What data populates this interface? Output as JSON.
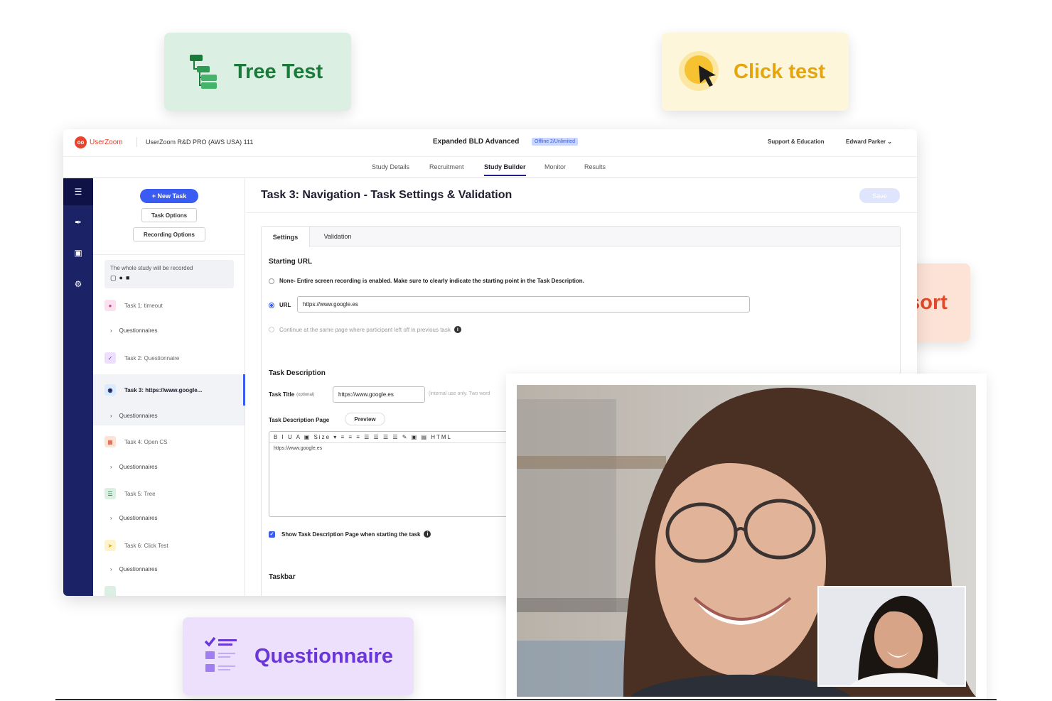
{
  "features": {
    "tree": "Tree Test",
    "click": "Click test",
    "card": "Card sort",
    "quest": "Questionnaire"
  },
  "topbar": {
    "brand": "UserZoom",
    "org": "UserZoom R&D PRO (AWS USA) 111",
    "study_title": "Expanded BLD Advanced",
    "badge": "Offline 2/Unlimited",
    "support": "Support & Education",
    "user": "Edward Parker ⌄"
  },
  "tabs": [
    "Study Details",
    "Recruitment",
    "Study Builder",
    "Monitor",
    "Results"
  ],
  "sidebar": {
    "new_task": "+ New Task",
    "task_options": "Task Options",
    "recording_options": "Recording Options",
    "recording_note": "The whole study will be recorded",
    "tasks": [
      "Task 1: timeout",
      "Task 2: Questionnaire",
      "Task 3: https://www.google...",
      "Task 4: Open CS",
      "Task 5: Tree",
      "Task 6: Click Test"
    ],
    "questionnaires": "Questionnaires"
  },
  "main": {
    "title": "Task 3: Navigation - Task Settings & Validation",
    "save": "Save",
    "tab_settings": "Settings",
    "tab_validation": "Validation",
    "starting_url": "Starting URL",
    "none_label": "None",
    "none_desc": " - Entire screen recording is enabled. Make sure to clearly indicate the starting point in the Task Description.",
    "url_label": "URL",
    "url_value": "https://www.google.es",
    "continue_label": "Continue at the same page where participant left off in previous task",
    "task_description": "Task Description",
    "task_title_label": "Task Title",
    "task_title_optional": "(optional)",
    "task_title_value": "https://www.google.es",
    "task_title_hint": "(internal use only. Two word",
    "desc_page_label": "Task Description Page",
    "preview": "Preview",
    "editor_tools": "B I U A ▣ Size ▾ ≡ ≡ ≡ ☰ ☰ ☰ ☰ ✎ ▣ ▤ HTML",
    "editor_body": "https://www.google.es",
    "show_desc": "Show Task Description Page when starting the task",
    "taskbar": "Taskbar"
  },
  "colors": {
    "rail": "#1c2266",
    "accent": "#3a5cf2",
    "tree": "#197a3a",
    "click": "#e4a50f",
    "card": "#e04a2b",
    "quest": "#6a36d8"
  }
}
